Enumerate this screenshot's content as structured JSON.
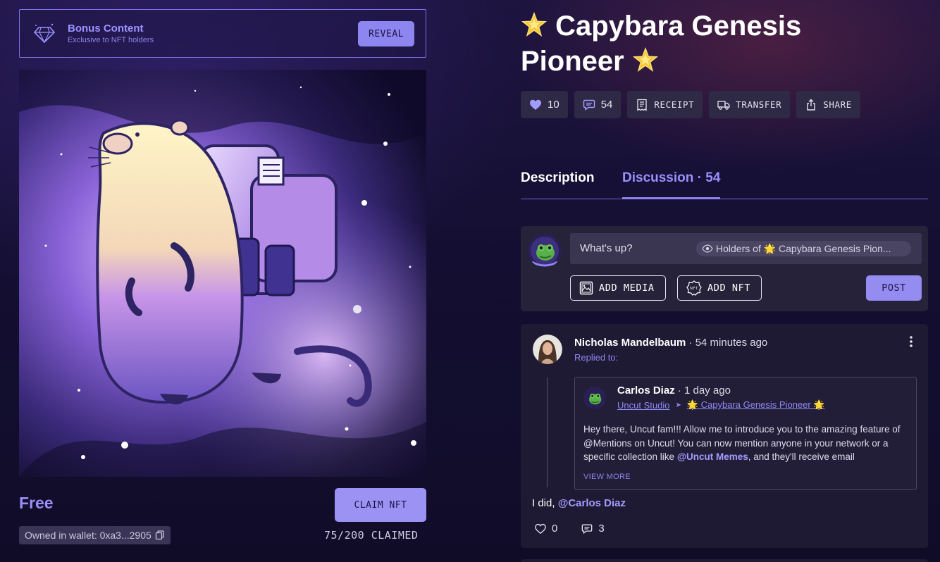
{
  "bonus": {
    "title": "Bonus Content",
    "subtitle": "Exclusive to NFT holders",
    "reveal_label": "REVEAL",
    "icon": "diamond-icon"
  },
  "artwork": {
    "alt": "capybara-astronaut-artwork"
  },
  "listing": {
    "price": "Free",
    "claim_label": "CLAIM NFT",
    "wallet": "Owned in wallet: 0xa3...2905",
    "claimed": "75/200 CLAIMED"
  },
  "nft": {
    "title_line1": "Capybara Genesis",
    "title_line2": "Pioneer"
  },
  "actions": {
    "likes": "10",
    "comments": "54",
    "receipt": "RECEIPT",
    "transfer": "TRANSFER",
    "share": "SHARE"
  },
  "tabs": {
    "description": "Description",
    "discussion": "Discussion · 54"
  },
  "composer": {
    "placeholder": "What's up?",
    "audience": "Holders of 🌟 Capybara Genesis Pion...",
    "add_media": "ADD MEDIA",
    "add_nft": "ADD NFT",
    "post": "POST"
  },
  "post": {
    "author": "Nicholas Mandelbaum",
    "time": " · 54 minutes ago",
    "replied_to": "Replied to:",
    "reply_prefix": "I did, ",
    "reply_mention": "@Carlos Diaz",
    "likes": "0",
    "comments": "3",
    "quoted": {
      "author": "Carlos Diaz",
      "time": " · 1 day ago",
      "studio": "Uncut Studio",
      "collection": "🌟 Capybara Genesis Pioneer 🌟",
      "body_part1": "Hey there, Uncut fam!!! Allow me to introduce you to the amazing feature of @Mentions on Uncut! You can now mention anyone in your network or a specific collection like ",
      "body_mention": "@Uncut Memes",
      "body_part2": ", and they'll receive email",
      "view_more": "VIEW MORE"
    }
  },
  "colors": {
    "accent": "#9b92f3",
    "accent_text": "#8e86f0",
    "panel": "#262239",
    "background": "#140f32"
  }
}
